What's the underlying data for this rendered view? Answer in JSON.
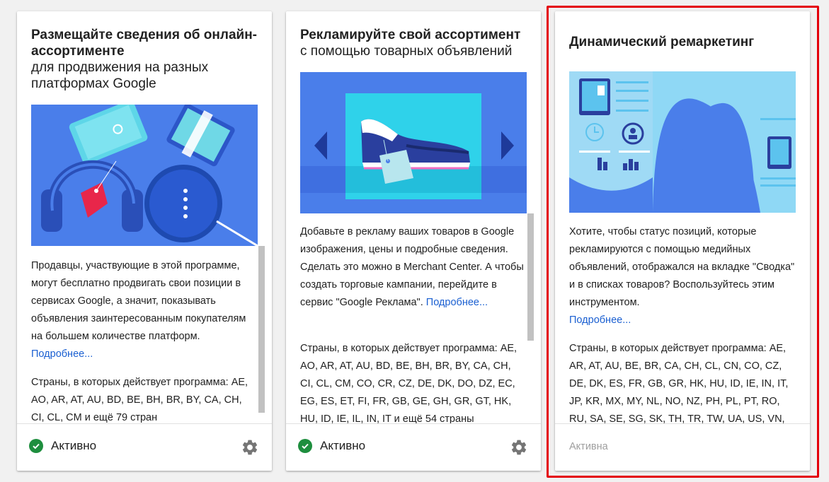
{
  "cards": [
    {
      "title_bold": "Размещайте сведения об онлайн-ассортименте",
      "title_sub": "для продвижения на разных платформах Google",
      "description": "Продавцы, участвующие в этой программе, могут бесплатно продвигать свои позиции в сервисах Google, а значит, показывать объявления заинтересованным покупателям на большем количестве платформ.",
      "more_link": "Подробнее...",
      "countries": "Страны, в которых действует программа: AE, AO, AR, AT, AU, BD, BE, BH, BR, BY, CA, CH, CI, CL, CM и ещё 79 стран",
      "status": "Активно",
      "illustration": "devices-headphones-illustration"
    },
    {
      "title_bold": "Рекламируйте свой ассортимент",
      "title_sub": "с помощью товарных объявлений",
      "description": "Добавьте в рекламу ваших товаров в Google изображения, цены и подробные сведения. Сделать это можно в Merchant Center. А чтобы создать торговые кампании, перейдите в сервис \"Google Реклама\".",
      "more_link": "Подробнее...",
      "countries": "Страны, в которых действует программа: AE, AO, AR, AT, AU, BD, BE, BH, BR, BY, CA, CH, CI, CL, CM, CO, CR, CZ, DE, DK, DO, DZ, EC, EG, ES, ET, FI, FR, GB, GE, GH, GR, GT, HK, HU, ID, IE, IL, IN, IT и ещё 54 страны",
      "status": "Активно",
      "illustration": "sneaker-carousel-illustration"
    },
    {
      "title_bold": "Динамический ремаркетинг",
      "description": "Хотите, чтобы статус позиций, которые рекламируются с помощью медийных объявлений, отображался на вкладке \"Сводка\" и в списках товаров? Воспользуйтесь этим инструментом.",
      "more_link": "Подробнее...",
      "countries": "Страны, в которых действует программа: AE, AR, AT, AU, BE, BR, CA, CH, CL, CN, CO, CZ, DE, DK, ES, FR, GB, GR, HK, HU, ID, IE, IN, IT, JP, KR, MX, MY, NL, NO, NZ, PH, PL, PT, RO, RU, SA, SE, SG, SK, TH, TR, TW, UA, US, VN, ZA",
      "status": "Активна",
      "illustration": "dynamic-remarketing-illustration"
    }
  ],
  "colors": {
    "link": "#1a5fd1",
    "status_active": "#1e8e3e",
    "highlight_border": "#e4000b",
    "illustration_blue": "#4a7eea"
  },
  "icons": {
    "status": "check-circle-icon",
    "settings": "gear-icon"
  }
}
